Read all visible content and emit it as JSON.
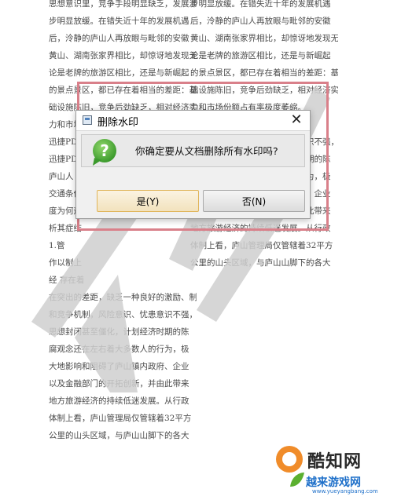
{
  "document": {
    "left_lines": [
      "思想意识里，竞争手段明显缺乏，发展滞",
      "步明显放缓。在错失近十年的发展机遇",
      "后，泠静的庐山人再放眼与毗邻的安徽",
      "黄山、湖南张家界相比，却惊讶地发现无",
      "论是老牌的旅游区相比，还是与新崛起",
      "的景点景区，都已存在着相当的差距：基",
      "础设施陈旧，竞争后劲缺乏，相对经济实",
      "力和市场份额占有率极度萎缩。",
      "迅捷PDF编辑器",
      "迅捷PDF编辑器",
      "  庐山人",
      "交通条件",
      "度为何远",
      "析其症结",
      "  1.管",
      "作以制上",
      "经  存在着",
      "在突出的差距，缺乏一种良好的激励、制约",
      "和竞争机制，风险意识、忧患意识不强，",
      "思想封闭甚至僵化，计划经济时期的陈",
      "腐观念还在左右着大多数人的行为，极",
      "大地影响和阻碍了庐山镇内政府、企业",
      "以及金融部门的开拓创新，并由此带来",
      "地方旅游经济的持续低迷发展。从行政",
      "体制上看，庐山管理局仅管辖着32平方",
      "公里的山头区域，与庐山山脚下的各大"
    ],
    "right_lines": [
      "步明显放缓。在错失近十年的发展机遇",
      "后，泠静的庐山人再放眼与毗邻的安徽",
      "黄山、湖南张家界相比，却惊讶地发现无",
      "论是老牌的旅游区相比，还是与新崛起",
      "的景点景区，都已存在着相当的差距：基",
      "础设施陈旧，竞争后劲缺乏，相对经济实",
      "力和市场份额占有率极度萎缩。",
      "迅捷PDF编辑器",
      "",
      "",
      "",
      "",
      "",
      "和竞争机制，风险意识、忧患意识不强，",
      "思想封闭甚至僵化，计划经济时期的陈",
      "腐观念还在左右着大多数人的行为，极",
      "大地影响和阻碍了庐山镇内政府、企业",
      "以及金融部门的开拓创新，并由此带来",
      "地方旅游经济的持续低迷发展。从行政",
      "体制上看，庐山管理局仅管辖着32平方",
      "公里的山头区域，与庐山山脚下的各大"
    ]
  },
  "dialog": {
    "title": "删除水印",
    "close_glyph": "✕",
    "message": "你确定要从文档删除所有水印吗?",
    "yes_label": "是(Y)",
    "no_label": "否(N)",
    "icon": "question-icon",
    "accent_color": "#4aa83a"
  },
  "logo": {
    "brand": "酷知网",
    "tagline": "越来游戏网",
    "url": "www.yueyangbang.com"
  }
}
